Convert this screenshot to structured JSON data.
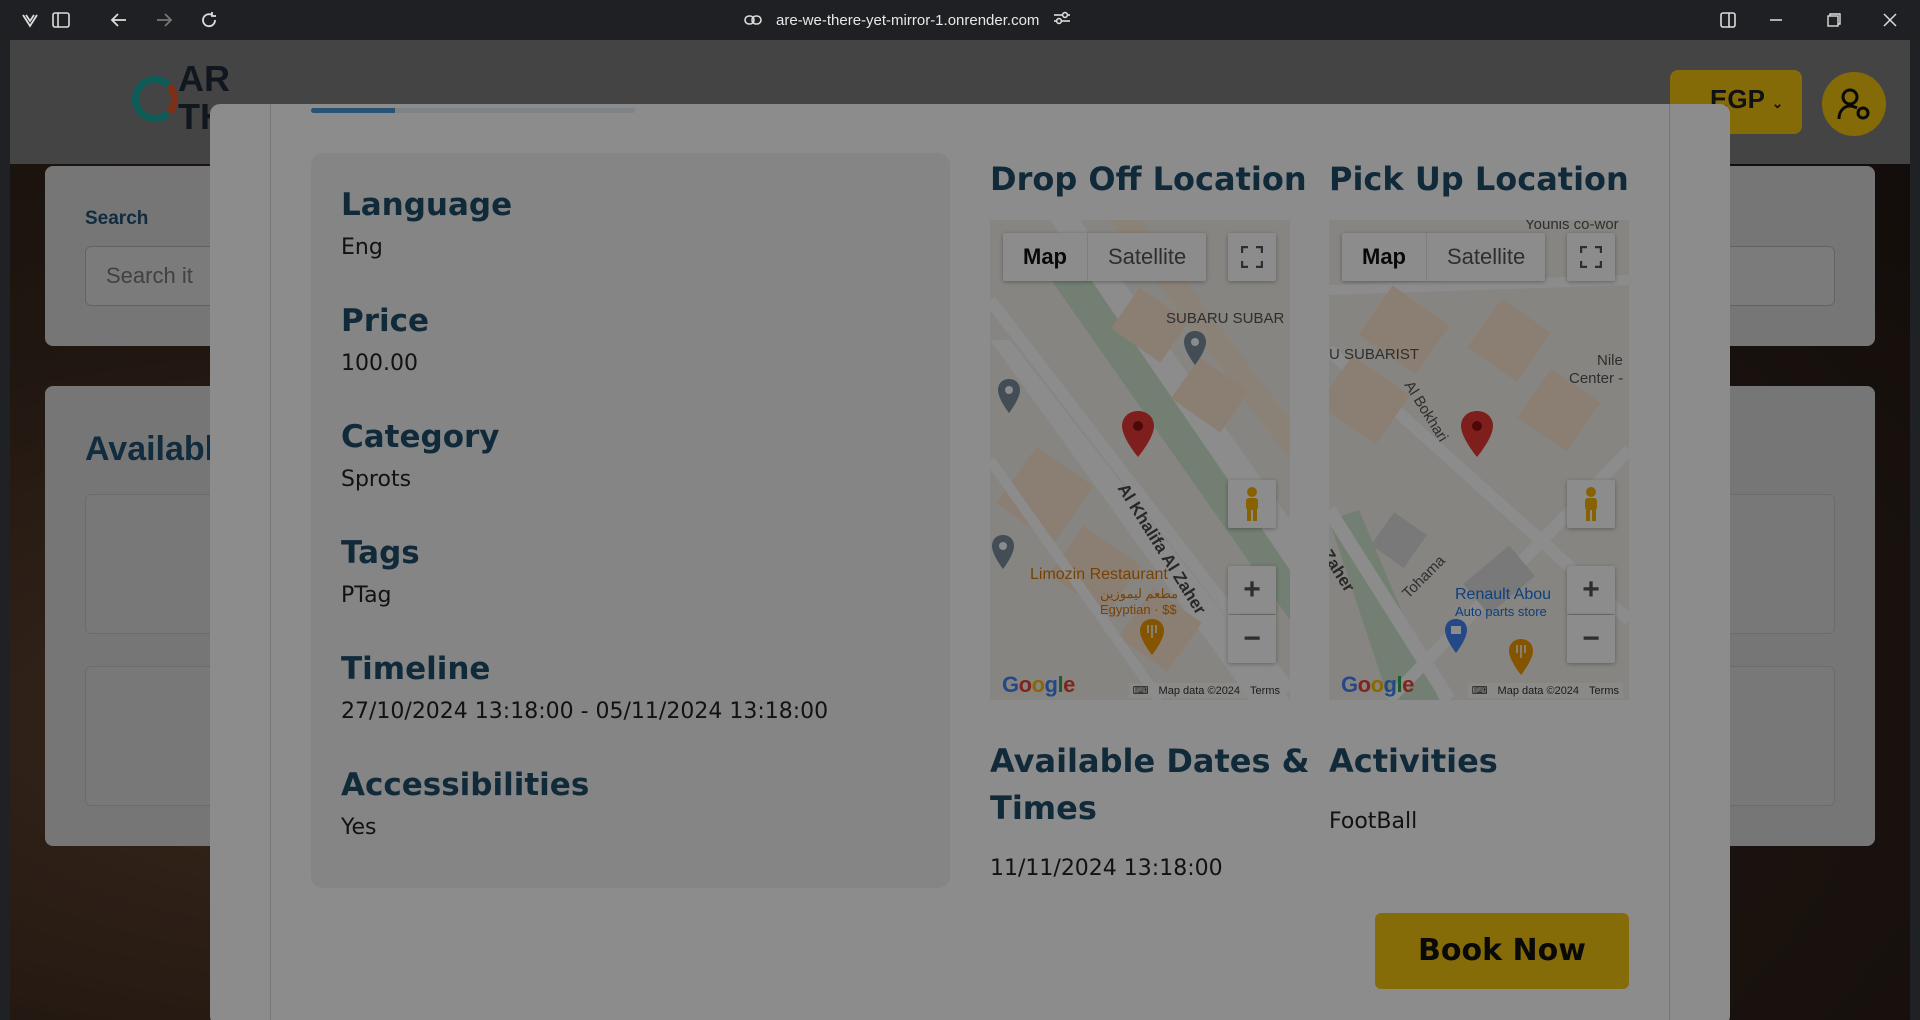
{
  "browser": {
    "url": "are-we-there-yet-mirror-1.onrender.com"
  },
  "site": {
    "logo_text": "ARE WE\nTHERE",
    "currency": "EGP",
    "search_label": "Search",
    "search_placeholder": "Search it",
    "available_title": "Available"
  },
  "modal": {
    "progress_fraction": 0.26,
    "details": [
      {
        "title": "Language",
        "value": "Eng"
      },
      {
        "title": "Price",
        "value": "100.00"
      },
      {
        "title": "Category",
        "value": "Sprots"
      },
      {
        "title": "Tags",
        "value": "PTag"
      },
      {
        "title": "Timeline",
        "value": "27/10/2024 13:18:00 - 05/11/2024 13:18:00"
      },
      {
        "title": "Accessibilities",
        "value": "Yes"
      }
    ],
    "dropoff": {
      "title": "Drop Off Location",
      "map_tab": "Map",
      "satellite_tab": "Satellite",
      "labels": {
        "subaru": "SUBARU SUBAR",
        "street": "Al Khalifa Al Zaher",
        "restaurant": "Limozin Restaurant",
        "restaurant_ar": "مطعم ليموزين",
        "restaurant_sub": "Egyptian · $$"
      },
      "footer_data": "Map data ©2024",
      "footer_terms": "Terms",
      "google": "Google"
    },
    "pickup": {
      "title": "Pick Up Location",
      "map_tab": "Map",
      "satellite_tab": "Satellite",
      "labels": {
        "younis": "Younis co-wor",
        "subarist": "U SUBARIST",
        "nile": "Nile",
        "center": "Center -",
        "bokhari": "Al Bokhari",
        "zaher": "l Zaher",
        "tohama": "Tohama",
        "renault": "Renault Abou",
        "renault_sub": "Auto parts store"
      },
      "footer_data": "Map data ©2024",
      "footer_terms": "Terms",
      "google": "Google"
    },
    "dates_title": "Available Dates & Times",
    "dates_value": "11/11/2024 13:18:00",
    "activities_title": "Activities",
    "activities_value": "FootBall",
    "book_label": "Book Now"
  },
  "colors": {
    "accent_yellow": "#f2c511",
    "heading_blue": "#1f4d6b",
    "progress_blue": "#4a97d6"
  },
  "icons": [
    "app-logo-icon",
    "sidebar-icon",
    "back-icon",
    "forward-icon",
    "reload-icon",
    "link-icon",
    "site-settings-icon",
    "split-view-icon",
    "minimize-icon",
    "maximize-icon",
    "close-icon",
    "profile-settings-icon",
    "fullscreen-icon",
    "pegman-icon",
    "zoom-in-icon",
    "zoom-out-icon",
    "map-pin-icon",
    "keyboard-icon"
  ]
}
